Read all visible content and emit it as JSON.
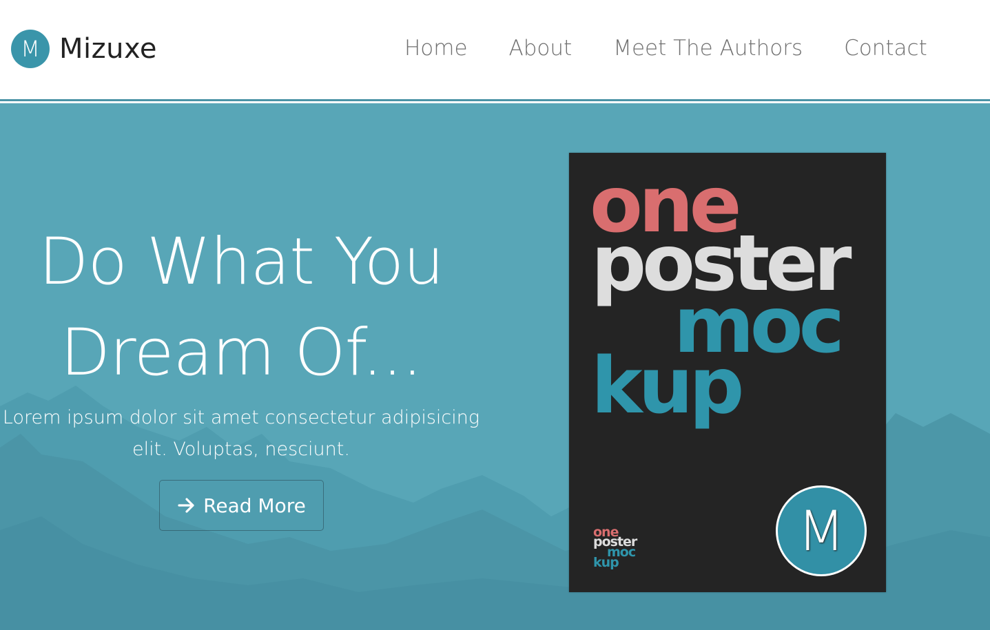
{
  "brand": {
    "logo_letter": "M",
    "name": "Mizuxe"
  },
  "nav": {
    "items": [
      {
        "label": "Home"
      },
      {
        "label": "About"
      },
      {
        "label": "Meet The Authors"
      },
      {
        "label": "Contact"
      }
    ]
  },
  "hero": {
    "title_line1": "Do What You",
    "title_line2": "Dream Of...",
    "text_line1": "Lorem ipsum dolor sit amet consectetur adipisicing",
    "text_line2": "elit. Voluptas, nesciunt.",
    "button_label": "Read More",
    "button_icon": "arrow-right-icon"
  },
  "poster": {
    "words": [
      "one",
      "poster",
      "moc",
      "kup"
    ],
    "logo_letter": "M"
  },
  "colors": {
    "accent": "#3a95aa",
    "hero_bg": "#58a6b7",
    "poster_bg": "#242424",
    "poster_red": "#d96e6f",
    "poster_light": "#dddddd",
    "poster_teal": "#2f95ab"
  }
}
